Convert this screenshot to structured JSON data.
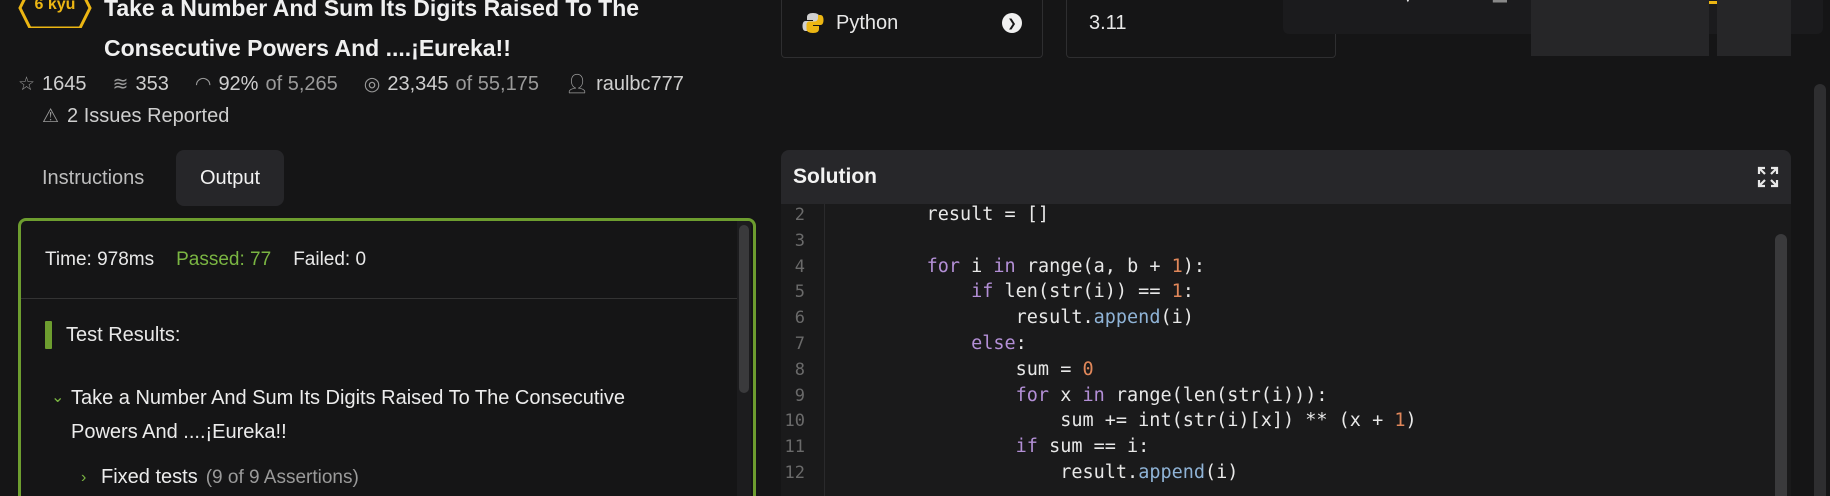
{
  "kata": {
    "rank": "6 kyu",
    "title": "Take a Number And Sum Its Digits Raised To The Consecutive Powers And ....¡Eureka!!",
    "stats": {
      "stars": "1645",
      "collections": "353",
      "satisfaction": "92%",
      "satisfaction_of": "of 5,265",
      "completed": "23,345",
      "completed_of": "of 55,175",
      "author": "raulbc777"
    },
    "issues": "2 Issues Reported"
  },
  "tabs": [
    {
      "label": "Instructions",
      "active": false
    },
    {
      "label": "Output",
      "active": true
    }
  ],
  "output": {
    "time": "Time: 978ms",
    "passed": "Passed: 77",
    "failed": "Failed: 0",
    "results_heading": "Test Results:",
    "describe_title": "Take a Number And Sum Its Digits Raised To The Consecutive Powers And ....¡Eureka!!",
    "group_label": "Fixed tests",
    "group_assertions": "(9 of 9 Assertions)"
  },
  "language": {
    "selected": "Python",
    "version": "3.11"
  },
  "solution": {
    "header": "Solution",
    "lines": [
      {
        "n": "2",
        "tokens": [
          [
            "plain",
            "    result = []"
          ]
        ]
      },
      {
        "n": "3",
        "tokens": []
      },
      {
        "n": "4",
        "tokens": [
          [
            "plain",
            "    "
          ],
          [
            "kw",
            "for"
          ],
          [
            "plain",
            " i "
          ],
          [
            "kw",
            "in"
          ],
          [
            "plain",
            " range(a, b + "
          ],
          [
            "num",
            "1"
          ],
          [
            "plain",
            "):"
          ]
        ]
      },
      {
        "n": "5",
        "tokens": [
          [
            "plain",
            "        "
          ],
          [
            "kw",
            "if"
          ],
          [
            "plain",
            " len(str(i)) == "
          ],
          [
            "num",
            "1"
          ],
          [
            "plain",
            ":"
          ]
        ]
      },
      {
        "n": "6",
        "tokens": [
          [
            "plain",
            "            result."
          ],
          [
            "attr",
            "append"
          ],
          [
            "plain",
            "(i)"
          ]
        ]
      },
      {
        "n": "7",
        "tokens": [
          [
            "plain",
            "        "
          ],
          [
            "kw",
            "else"
          ],
          [
            "plain",
            ":"
          ]
        ]
      },
      {
        "n": "8",
        "tokens": [
          [
            "plain",
            "            sum = "
          ],
          [
            "num",
            "0"
          ]
        ]
      },
      {
        "n": "9",
        "tokens": [
          [
            "plain",
            "            "
          ],
          [
            "kw",
            "for"
          ],
          [
            "plain",
            " x "
          ],
          [
            "kw",
            "in"
          ],
          [
            "plain",
            " range(len(str(i))):"
          ]
        ]
      },
      {
        "n": "10",
        "tokens": [
          [
            "plain",
            "                sum += int(str(i)[x]) ** (x + "
          ],
          [
            "num",
            "1"
          ],
          [
            "plain",
            ")"
          ]
        ]
      },
      {
        "n": "11",
        "tokens": [
          [
            "plain",
            "            "
          ],
          [
            "kw",
            "if"
          ],
          [
            "plain",
            " sum == i:"
          ]
        ]
      },
      {
        "n": "12",
        "tokens": [
          [
            "plain",
            "                result."
          ],
          [
            "attr",
            "append"
          ],
          [
            "plain",
            "(i)"
          ]
        ]
      }
    ]
  },
  "colors": {
    "accent_green": "#6d9d2f",
    "passed_green": "#7ab542",
    "kyu_yellow": "#ecb613",
    "background": "#151516"
  },
  "icons": {
    "stars": "star-outline-icon",
    "collections": "stack-icon",
    "satisfaction": "gauge-icon",
    "completed": "target-icon",
    "author": "user-icon",
    "issues": "warning-icon",
    "language": "python-icon",
    "dropdown": "chevron-down-circle-icon",
    "expand": "expand-icon"
  }
}
